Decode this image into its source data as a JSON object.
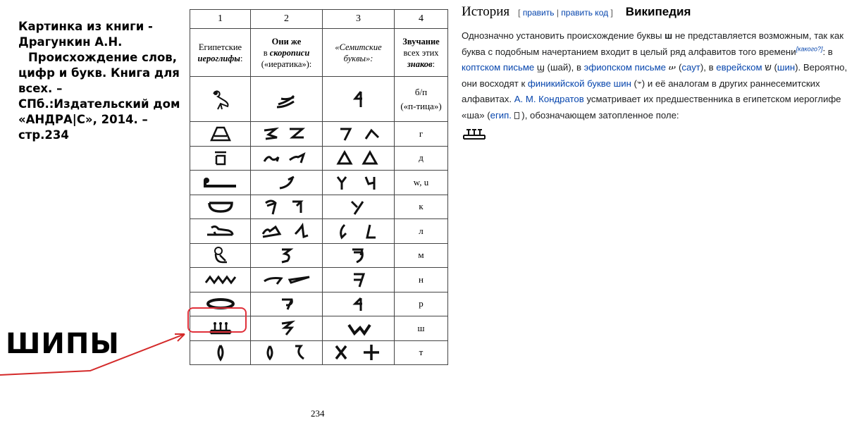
{
  "caption": {
    "lines": [
      "Картинка из книги -",
      "Драгункин А.Н.",
      "Происхождение слов,",
      "цифр и букв. Книга для",
      "всех. –",
      "СПб.:Издательский дом",
      "«АНДРА|С», 2014. –",
      "стр.234"
    ]
  },
  "label": "ШИПЫ",
  "table": {
    "col_numbers": [
      "1",
      "2",
      "3",
      "4"
    ],
    "headers": {
      "c1_a": "Египетские",
      "c1_b": "иероглифы",
      "c1_c": ":",
      "c2_a": "Они же",
      "c2_b": "в ",
      "c2_c": "скорописи",
      "c2_d": "(«иератика»):",
      "c3_a": "«Семитские",
      "c3_b": "буквы»:",
      "c4_a": "Звучание",
      "c4_b": "всех этих",
      "c4_c": "знаков",
      "c4_d": ":"
    },
    "sounds": [
      "б/п",
      "(«п-тица»)",
      "г",
      "д",
      "w, u",
      "к",
      "л",
      "м",
      "н",
      "р",
      "ш",
      "т"
    ]
  },
  "page_number": "234",
  "wiki": {
    "title": "История",
    "edit_open": "[",
    "edit_link": "править",
    "edit_sep": "|",
    "edit_code": "править код",
    "edit_close": "]",
    "source": "Википедия",
    "t1": "Однозначно установить происхождение буквы ",
    "letter": "ш",
    "t2": " не представляется возможным, так как буква с подобным начертанием входит в целый ряд алфавитов того времени",
    "sup": "[какого?]",
    "t3": ": в ",
    "coptic": "коптском письме",
    "t4": " ϣ (шай), в ",
    "ethiopic": "эфиопском письме",
    "t5": " ሠ (",
    "saut": "саут",
    "t6": "), в ",
    "hebrew": "еврейском",
    "t7": " ש (",
    "shin": "шин",
    "t8": "). Вероятно, они восходят к ",
    "phoenician": "финикийской букве шин",
    "t9": " (𐤔) и её аналогам в других раннесемитских алфавитах. ",
    "kondratov": "А. М. Кондратов",
    "t10": " усматривает их предшественника в египетском иероглифе «ша» (",
    "egip": "егип.",
    "t11": " ), обозначающем затопленное поле:"
  },
  "colors": {
    "link": "#0645ad",
    "highlight": "#e0303a"
  }
}
